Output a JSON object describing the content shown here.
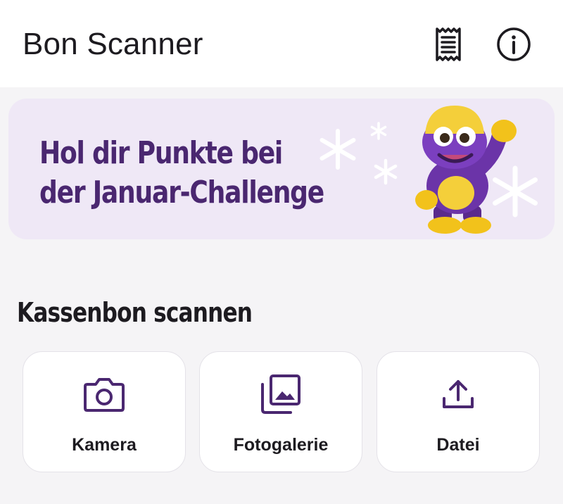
{
  "app_bar": {
    "title": "Bon Scanner",
    "receipt_icon": "receipt-list-icon",
    "info_icon": "info-icon"
  },
  "banner": {
    "headline": "Hol dir Punkte bei\nder Januar-Challenge",
    "background": "#efe8f6",
    "text_color": "#4a2770"
  },
  "scan_section": {
    "title": "Kassenbon scannen",
    "options": [
      {
        "label": "Kamera",
        "icon": "camera-icon"
      },
      {
        "label": "Fotogalerie",
        "icon": "photo-gallery-icon"
      },
      {
        "label": "Datei",
        "icon": "upload-icon"
      }
    ]
  },
  "colors": {
    "accent": "#4a2770",
    "card_background": "#ffffff",
    "page_background": "#f5f4f6"
  }
}
